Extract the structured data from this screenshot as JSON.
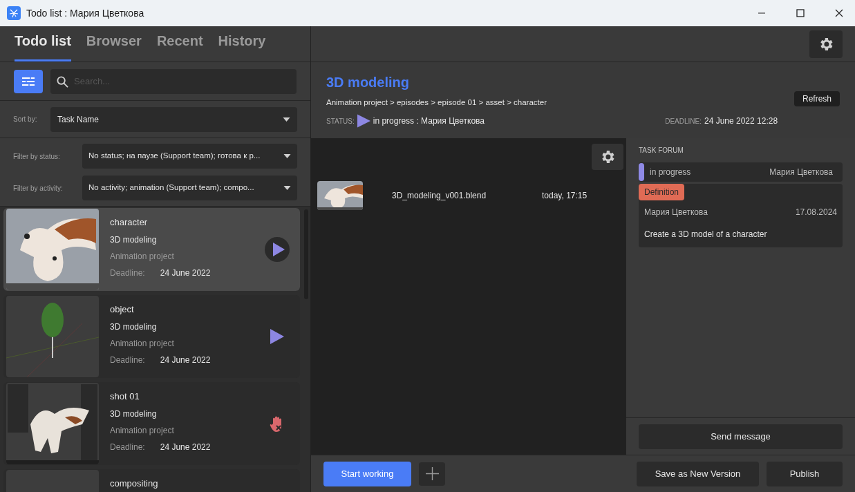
{
  "window": {
    "title": "Todo list : Мария Цветкова"
  },
  "tabs": [
    {
      "label": "Todo list",
      "selected": true
    },
    {
      "label": "Browser",
      "selected": false
    },
    {
      "label": "Recent",
      "selected": false
    },
    {
      "label": "History",
      "selected": false
    }
  ],
  "search": {
    "placeholder": "Search..."
  },
  "sort": {
    "label": "Sort by:",
    "value": "Task Name"
  },
  "filters": [
    {
      "label": "Filter by status:",
      "value": "No status; на паузе (Support team); готова к р..."
    },
    {
      "label": "Filter by activity:",
      "value": "No activity; animation (Support team); compo..."
    }
  ],
  "tasks": [
    {
      "name": "character",
      "task": "3D modeling",
      "project": "Animation project",
      "deadline_label": "Deadline:",
      "deadline": "24 June 2022",
      "selected": true,
      "kind": "play-circle"
    },
    {
      "name": "object",
      "task": "3D modeling",
      "project": "Animation project",
      "deadline_label": "Deadline:",
      "deadline": "24 June 2022",
      "selected": false,
      "kind": "play"
    },
    {
      "name": "shot 01",
      "task": "3D modeling",
      "project": "Animation project",
      "deadline_label": "Deadline:",
      "deadline": "24 June 2022",
      "selected": false,
      "kind": "blocked"
    },
    {
      "name": "compositing",
      "selected": false
    }
  ],
  "detail": {
    "title": "3D modeling",
    "path": "Animation project > episodes > episode 01 > asset > character",
    "status_label": "STATUS:",
    "status_text": "in progress : Мария Цветкова",
    "deadline_label": "DEADLINE:",
    "deadline": "24 June 2022 12:28",
    "refresh": "Refresh"
  },
  "files": [
    {
      "name": "3D_modeling_v001.blend",
      "time": "today, 17:15"
    }
  ],
  "forum": {
    "title": "TASK FORUM",
    "status": {
      "label": "in progress",
      "author": "Мария Цветкова"
    },
    "messages": [
      {
        "tag": "Definition",
        "author": "Мария Цветкова",
        "date": "17.08.2024",
        "text": "Create a 3D model of a character"
      }
    ],
    "send": "Send message"
  },
  "actions": {
    "start": "Start working",
    "save": "Save as New Version",
    "publish": "Publish"
  }
}
